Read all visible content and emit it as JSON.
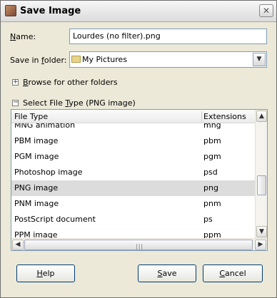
{
  "window": {
    "title": "Save Image",
    "close_glyph": "✕"
  },
  "form": {
    "name_label_pre": "",
    "name_label_mnemonic": "N",
    "name_label_post": "ame:",
    "name_value": "Lourdes (no filter).png",
    "folder_label_pre": "Save in ",
    "folder_label_mnemonic": "f",
    "folder_label_post": "older:",
    "folder_value": "My Pictures"
  },
  "browse": {
    "expander": "+",
    "label_mnemonic": "B",
    "label_rest": "rowse for other folders"
  },
  "filetype": {
    "expander": "−",
    "label_pre": "Select File ",
    "label_mnemonic": "T",
    "label_post": "ype (PNG image)"
  },
  "table": {
    "columns": [
      "File Type",
      "Extensions"
    ],
    "rows": [
      {
        "type": "MNG animation",
        "ext": "mng"
      },
      {
        "type": "PBM image",
        "ext": "pbm"
      },
      {
        "type": "PGM image",
        "ext": "pgm"
      },
      {
        "type": "Photoshop image",
        "ext": "psd"
      },
      {
        "type": "PNG image",
        "ext": "png",
        "selected": true
      },
      {
        "type": "PNM image",
        "ext": "pnm"
      },
      {
        "type": "PostScript document",
        "ext": "ps"
      },
      {
        "type": "PPM image",
        "ext": "ppm"
      }
    ],
    "scroll_up": "▲",
    "scroll_down": "▼",
    "scroll_left": "◀",
    "scroll_right": "▶",
    "grip": "|||"
  },
  "buttons": {
    "help_mnemonic": "H",
    "help_rest": "elp",
    "save_mnemonic": "S",
    "save_rest": "ave",
    "cancel_mnemonic": "C",
    "cancel_rest": "ancel"
  },
  "icons": {
    "app": "photo-icon",
    "folder": "folder-icon",
    "dropdown": "chevron-down-icon"
  },
  "colors": {
    "accent_border": "#7f9db9",
    "selected_row": "#dcdcdc",
    "window_bg": "#ece9d8"
  }
}
